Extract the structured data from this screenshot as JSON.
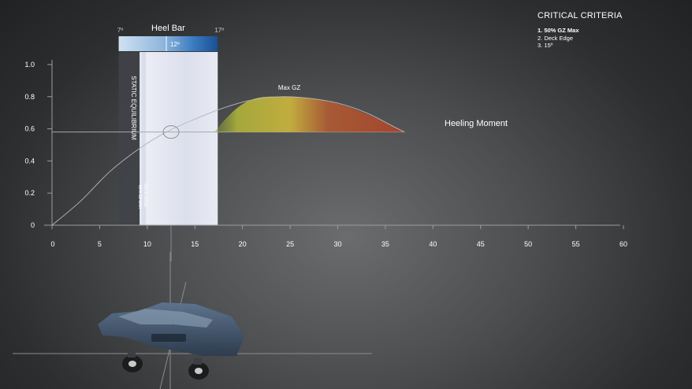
{
  "criteria": {
    "title": "CRITICAL CRITERIA",
    "items": [
      "1. 50% GZ Max",
      "2. Deck Edge",
      "3. 15º"
    ]
  },
  "heel_bar": {
    "title": "Heel Bar",
    "min_label": "7º",
    "max_label": "17º",
    "value_label": "12º",
    "min": 7,
    "max": 17,
    "value": 12
  },
  "bands": {
    "static_label": "STATIC EQUILIBRIUM",
    "static_from": 7,
    "static_to": 9.2,
    "heel_from": 9.2,
    "heel_to": 17.4,
    "side_label_a": "DECK EDGE",
    "side_label_b": "50% GZ MAX"
  },
  "colors": {
    "gz_green": "#8a9a3a",
    "gz_yellow": "#c2ac3e",
    "gz_red": "#a4452e",
    "axis": "#9a9ca0",
    "band_light": "#e6e8f2",
    "band_dark": "#404348",
    "heel_blue": "#1e5fa6"
  },
  "chart_data": {
    "type": "area",
    "x_ticks": [
      0,
      5,
      10,
      15,
      20,
      25,
      30,
      35,
      40,
      45,
      50,
      55,
      60
    ],
    "y_ticks": [
      1.0,
      0.8,
      0.6,
      0.4,
      0.2,
      0
    ],
    "y_tick_labels": [
      "1.0",
      "0.8",
      "0.6",
      "0.4",
      "0.2",
      "0"
    ],
    "xlim": [
      0,
      60
    ],
    "ylim": [
      0,
      1.0
    ],
    "heeling_moment_label": "Heeling Moment",
    "heeling_moment": 0.58,
    "max_gz_label": "Max GZ",
    "max_gz": {
      "x": 25,
      "y": 0.8
    },
    "equilibrium_point": {
      "x": 12.5,
      "y": 0.58
    },
    "gz_curve": {
      "x": [
        0,
        3,
        6,
        9,
        12,
        15,
        18,
        21,
        24,
        27,
        30,
        33,
        36,
        37
      ],
      "y": [
        0,
        0.15,
        0.33,
        0.47,
        0.58,
        0.66,
        0.73,
        0.78,
        0.8,
        0.79,
        0.76,
        0.7,
        0.61,
        0.58
      ]
    }
  }
}
